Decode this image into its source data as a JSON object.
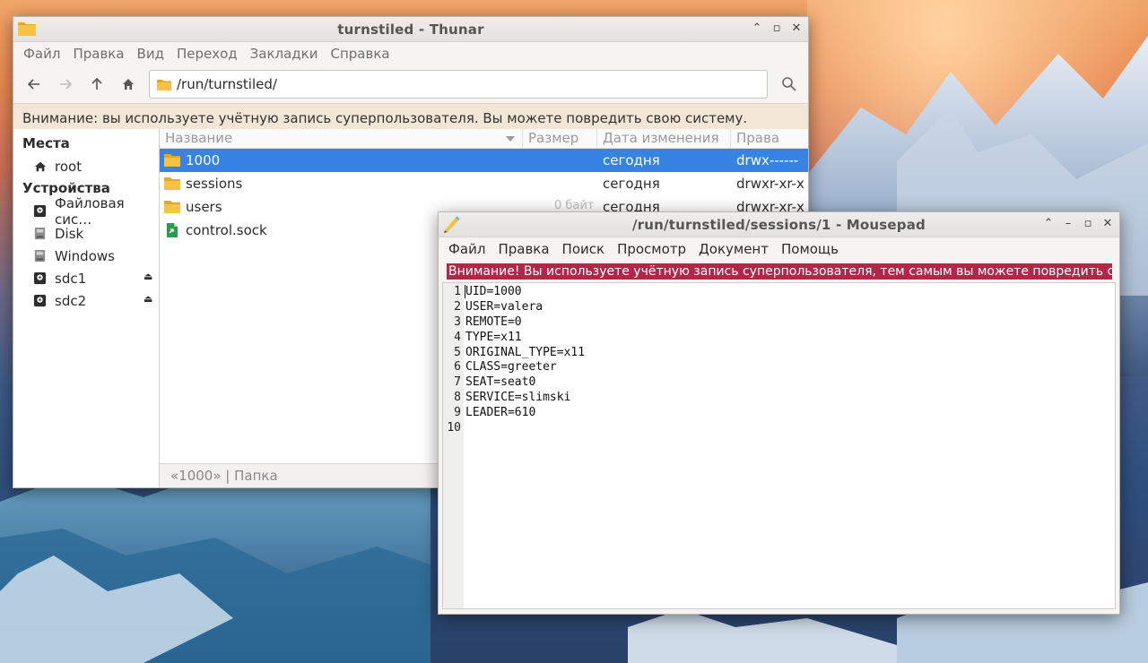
{
  "thunar": {
    "title": "turnstiled - Thunar",
    "menu": [
      "Файл",
      "Правка",
      "Вид",
      "Переход",
      "Закладки",
      "Справка"
    ],
    "path": "/run/turnstiled/",
    "warning": "Внимание: вы используете учётную запись суперпользователя. Вы можете повредить свою систему.",
    "sidebar": {
      "places_heading": "Места",
      "places": [
        {
          "label": "root",
          "icon": "home-icon"
        }
      ],
      "devices_heading": "Устройства",
      "devices": [
        {
          "label": "Файловая сис…",
          "icon": "drive-icon",
          "eject": false
        },
        {
          "label": "Disk",
          "icon": "disk-icon",
          "eject": false
        },
        {
          "label": "Windows",
          "icon": "disk-icon",
          "eject": false
        },
        {
          "label": "sdc1",
          "icon": "drive-icon",
          "eject": true
        },
        {
          "label": "sdc2",
          "icon": "drive-icon",
          "eject": true
        }
      ]
    },
    "columns": {
      "name": "Название",
      "size": "Размер",
      "date": "Дата изменения",
      "perm": "Права"
    },
    "files": [
      {
        "name": "1000",
        "icon": "folder-icon",
        "size": "",
        "date": "сегодня",
        "perm": "drwx------",
        "selected": true
      },
      {
        "name": "sessions",
        "icon": "folder-icon",
        "size": "",
        "date": "сегодня",
        "perm": "drwxr-xr-x",
        "selected": false
      },
      {
        "name": "users",
        "icon": "folder-icon",
        "size": "",
        "date": "сегодня",
        "perm": "drwxr-xr-x",
        "selected": false
      },
      {
        "name": "control.sock",
        "icon": "socket-file-icon",
        "size": "",
        "date": "",
        "perm": "",
        "selected": false
      }
    ],
    "ghost_text": "0 байт",
    "status": "«1000»  |  Папка"
  },
  "mousepad": {
    "title": "/run/turnstiled/sessions/1 - Mousepad",
    "menu": [
      "Файл",
      "Правка",
      "Поиск",
      "Просмотр",
      "Документ",
      "Помощь"
    ],
    "warning": "Внимание! Вы используете учётную запись суперпользователя, тем самым вы можете повредить систему.",
    "lines": [
      "UID=1000",
      "USER=valera",
      "REMOTE=0",
      "TYPE=x11",
      "ORIGINAL_TYPE=x11",
      "CLASS=greeter",
      "SEAT=seat0",
      "SERVICE=slimski",
      "LEADER=610",
      ""
    ]
  },
  "colors": {
    "selection": "#3584e4",
    "mousepad_warning": "#b22647",
    "thunar_warning": "#f2e6d6"
  }
}
